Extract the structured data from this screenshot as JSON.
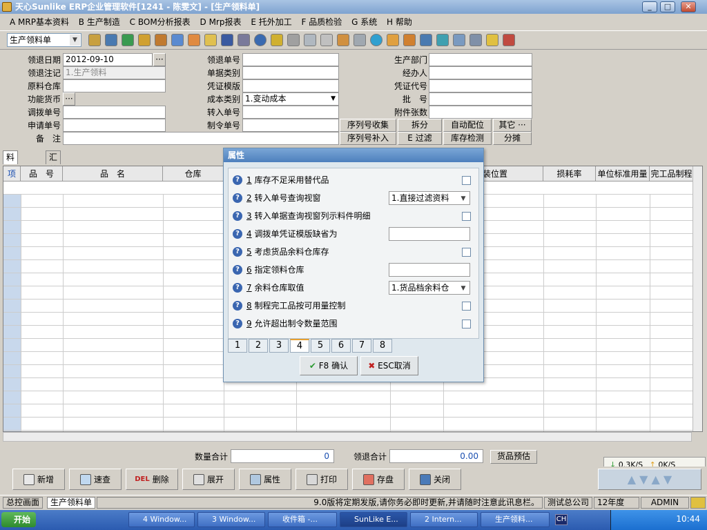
{
  "window": {
    "title": "天心Sunlike ERP企业管理软件[1241 - 陈雯文] - [生产领料单]",
    "min": "_",
    "max": "□",
    "close": "✕"
  },
  "menu": [
    "A MRP基本资料",
    "B 生产制造",
    "C BOM分析报表",
    "D Mrp报表",
    "E 托外加工",
    "F 品质检验",
    "G 系统",
    "H 帮助"
  ],
  "toolbar": {
    "doc_type": "生产领料单"
  },
  "form": {
    "labels": {
      "date": "领退日期",
      "flag": "领退注记",
      "warehouse": "原料仓库",
      "currency": "功能货币",
      "transfer_no": "调拨单号",
      "apply_no": "申请单号",
      "memo": "备　注",
      "doc_no": "领退单号",
      "doc_cat": "单据类别",
      "voucher_tpl": "凭证模版",
      "cost_cat": "成本类别",
      "in_no": "转入单号",
      "order_no": "制令单号",
      "dept": "生产部门",
      "handler": "经办人",
      "voucher_code": "凭证代号",
      "batch": "批　号",
      "attach": "附件张数"
    },
    "values": {
      "date": "2012-09-10",
      "flag": "1.生产领料",
      "cost_cat": "1.变动成本",
      "currency_btn": "···",
      "date_btn": "···"
    },
    "buttons": {
      "serial_collect": "序列号收集",
      "split": "拆分",
      "auto_alloc": "自动配位",
      "other": "其它 ···",
      "serial_add": "序列号补入",
      "filter": "E 过滤",
      "stock_check": "库存检测",
      "share": "分摊"
    }
  },
  "tabs": [
    "料件明细",
    "汇总"
  ],
  "grid": {
    "columns": [
      "项",
      "品　号",
      "品　名",
      "仓库",
      "装位置",
      "损耗率",
      "单位标准用量",
      "完工品制程"
    ]
  },
  "summary": {
    "qty_label": "数量合计",
    "qty_value": "0",
    "ret_label": "领退合计",
    "ret_value": "0.00",
    "forecast": "货品预估"
  },
  "net": {
    "down": "0.3K/S",
    "up": "0K/S"
  },
  "bottom_buttons": [
    "新增",
    "速查",
    "删除",
    "展开",
    "属性",
    "打印",
    "存盘",
    "关闭"
  ],
  "del_icon": "DEL",
  "status": {
    "home": "总控画面",
    "doc": "生产领料单",
    "notice": "9.0版将定期发版,请你务必即时更新,并请随时注意此讯息栏。",
    "company": "测试总公司",
    "year": "12年度",
    "user": "ADMIN"
  },
  "taskbar": {
    "start": "开始",
    "tasks": [
      "4 Window...",
      "3 Window...",
      "收件箱 -...",
      "SunLike E...",
      "2 Intern...",
      "生产领料..."
    ],
    "clock": "10:44",
    "lang": "CH"
  },
  "dialog": {
    "title": "属性",
    "options": [
      {
        "num": "1",
        "text": "库存不足采用替代品"
      },
      {
        "num": "2",
        "text": "转入单号查询视窗",
        "value": "1.直接过滤资料"
      },
      {
        "num": "3",
        "text": "转入单据查询视窗列示料件明细"
      },
      {
        "num": "4",
        "text": "调拨单凭证模版缺省为"
      },
      {
        "num": "5",
        "text": "考虑货品余料仓库存"
      },
      {
        "num": "6",
        "text": "指定领料仓库"
      },
      {
        "num": "7",
        "text": "余料仓库取值",
        "value": "1.货品档余料仓"
      },
      {
        "num": "8",
        "text": "制程完工品按可用量控制"
      },
      {
        "num": "9",
        "text": "允许超出制令数量范围"
      }
    ],
    "pages": [
      "1",
      "2",
      "3",
      "4",
      "5",
      "6",
      "7",
      "8"
    ],
    "ok": "F8 确认",
    "cancel": "ESC取消"
  }
}
